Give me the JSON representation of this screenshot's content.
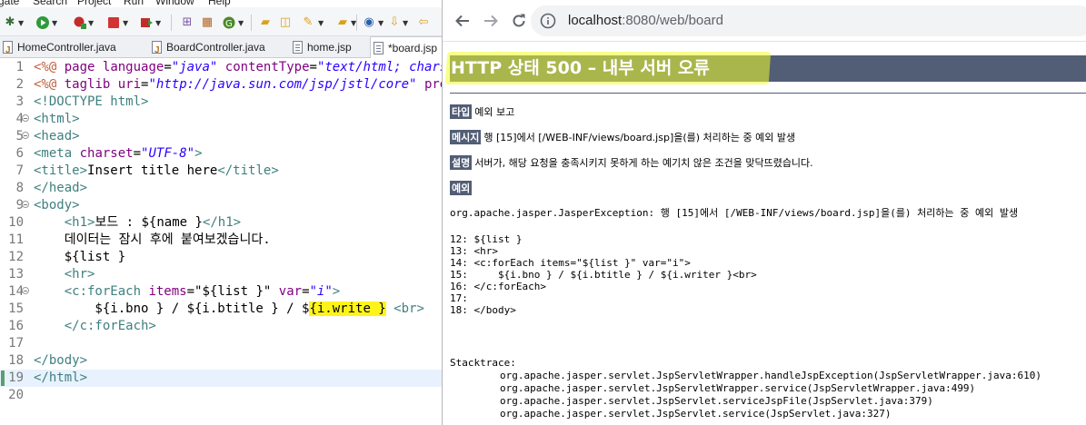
{
  "eclipse": {
    "menu": [
      "gate",
      "Search",
      "Project",
      "Run",
      "Window",
      "Help"
    ],
    "tabs": [
      {
        "label": "HomeController.java",
        "type": "java"
      },
      {
        "label": "BoardController.java",
        "type": "java"
      },
      {
        "label": "home.jsp",
        "type": "jsp"
      },
      {
        "label": "*board.jsp",
        "type": "jsp",
        "close": "✕"
      }
    ],
    "lines": [
      {
        "n": "1",
        "html": "<span class='dir'>&lt;%@</span> <span class='attr'>page</span> <span class='attr'>language</span>=<span class='str'>\"java\"</span> <span class='attr'>contentType</span>=<span class='str'>\"text/html; charset</span>"
      },
      {
        "n": "2",
        "html": "<span class='dir'>&lt;%@</span> <span class='attr'>taglib</span> <span class='attr'>uri</span>=<span class='str'>\"http://java.sun.com/jsp/jstl/core\"</span> <span class='attr'>prefi</span>"
      },
      {
        "n": "3",
        "html": "<span class='tagc'>&lt;!DOCTYPE html&gt;</span>"
      },
      {
        "n": "4",
        "fold": true,
        "html": "<span class='tagc'>&lt;html&gt;</span>"
      },
      {
        "n": "5",
        "fold": true,
        "html": "<span class='tagc'>&lt;head&gt;</span>"
      },
      {
        "n": "6",
        "html": "<span class='tagc'>&lt;meta</span> <span class='attr'>charset</span>=<span class='str'>\"UTF-8\"</span><span class='tagc'>&gt;</span>"
      },
      {
        "n": "7",
        "html": "<span class='tagc'>&lt;title&gt;</span>Insert title here<span class='tagc'>&lt;/title&gt;</span>"
      },
      {
        "n": "8",
        "html": "<span class='tagc'>&lt;/head&gt;</span>"
      },
      {
        "n": "9",
        "fold": true,
        "html": "<span class='tagc'>&lt;body&gt;</span>"
      },
      {
        "n": "10",
        "html": "    <span class='tagc'>&lt;h1&gt;</span>보드 : ${name }<span class='tagc'>&lt;/h1&gt;</span>"
      },
      {
        "n": "11",
        "html": "    데이터는 잠시 후에 붙여보겠습니다."
      },
      {
        "n": "12",
        "html": "    ${list }"
      },
      {
        "n": "13",
        "html": "    <span class='tagc'>&lt;hr&gt;</span>"
      },
      {
        "n": "14",
        "fold": true,
        "html": "    <span class='tagc'>&lt;c:forEach</span> <span class='attr'>items</span>=\"${list }\" <span class='attr'>var</span>=<span class='str'>\"i\"</span><span class='tagc'>&gt;</span>"
      },
      {
        "n": "15",
        "html": "        ${i.bno } / ${i.btitle } / $<span class='hl'>{i.write }</span> <span class='tagc'>&lt;br&gt;</span>"
      },
      {
        "n": "16",
        "html": "    <span class='tagc'>&lt;/c:forEach&gt;</span>"
      },
      {
        "n": "17",
        "html": ""
      },
      {
        "n": "18",
        "html": "<span class='tagc'>&lt;/body&gt;</span>"
      },
      {
        "n": "19",
        "cur": true,
        "html": "<span class='tagc'>&lt;/html&gt;</span>"
      },
      {
        "n": "20",
        "html": ""
      }
    ]
  },
  "browser": {
    "url_host": "localhost",
    "url_rest": ":8080/web/board",
    "title": "HTTP 상태 500 – 내부 서버 오류",
    "type_label": "타입",
    "type_value": "예외 보고",
    "message_label": "메시지",
    "message_value": "행 [15]에서 [/WEB-INF/views/board.jsp]을(를) 처리하는 중 예외 발생",
    "desc_label": "설명",
    "desc_value": "서버가, 해당 요청을 충족시키지 못하게 하는 예기치 않은 조건을 맞닥뜨렸습니다.",
    "exception_label": "예외",
    "exception_line": "org.apache.jasper.JasperException: 행 [15]에서 [/WEB-INF/views/board.jsp]을(를) 처리하는 중 예외 발생",
    "snippet": "12:\t${list }\n13:\t<hr>\n14:\t<c:forEach items=\"${list }\" var=\"i\">\n15:\t\t${i.bno } / ${i.btitle } / ${i.writer }<br>\n16:\t</c:forEach>\n17:\n18: </body>",
    "stacktrace_label": "Stacktrace:",
    "stacktrace": [
      "org.apache.jasper.servlet.JspServletWrapper.handleJspException(JspServletWrapper.java:610)",
      "org.apache.jasper.servlet.JspServletWrapper.service(JspServletWrapper.java:499)",
      "org.apache.jasper.servlet.JspServlet.serviceJspFile(JspServlet.java:379)",
      "org.apache.jasper.servlet.JspServlet.service(JspServlet.java:327)"
    ]
  }
}
